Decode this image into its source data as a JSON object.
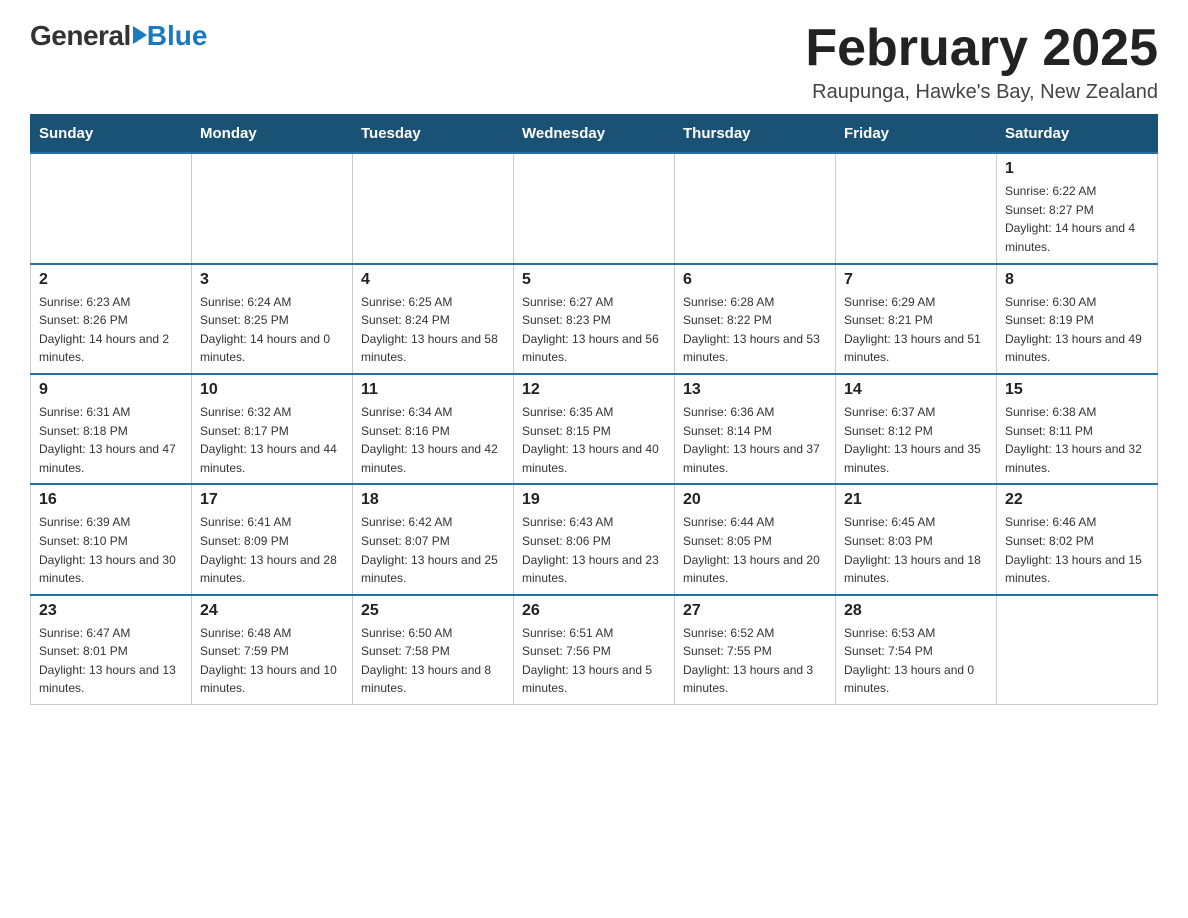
{
  "header": {
    "logo": {
      "general": "General",
      "blue": "Blue"
    },
    "title": "February 2025",
    "location": "Raupunga, Hawke's Bay, New Zealand"
  },
  "weekdays": [
    "Sunday",
    "Monday",
    "Tuesday",
    "Wednesday",
    "Thursday",
    "Friday",
    "Saturday"
  ],
  "weeks": [
    [
      {
        "day": "",
        "info": ""
      },
      {
        "day": "",
        "info": ""
      },
      {
        "day": "",
        "info": ""
      },
      {
        "day": "",
        "info": ""
      },
      {
        "day": "",
        "info": ""
      },
      {
        "day": "",
        "info": ""
      },
      {
        "day": "1",
        "info": "Sunrise: 6:22 AM\nSunset: 8:27 PM\nDaylight: 14 hours and 4 minutes."
      }
    ],
    [
      {
        "day": "2",
        "info": "Sunrise: 6:23 AM\nSunset: 8:26 PM\nDaylight: 14 hours and 2 minutes."
      },
      {
        "day": "3",
        "info": "Sunrise: 6:24 AM\nSunset: 8:25 PM\nDaylight: 14 hours and 0 minutes."
      },
      {
        "day": "4",
        "info": "Sunrise: 6:25 AM\nSunset: 8:24 PM\nDaylight: 13 hours and 58 minutes."
      },
      {
        "day": "5",
        "info": "Sunrise: 6:27 AM\nSunset: 8:23 PM\nDaylight: 13 hours and 56 minutes."
      },
      {
        "day": "6",
        "info": "Sunrise: 6:28 AM\nSunset: 8:22 PM\nDaylight: 13 hours and 53 minutes."
      },
      {
        "day": "7",
        "info": "Sunrise: 6:29 AM\nSunset: 8:21 PM\nDaylight: 13 hours and 51 minutes."
      },
      {
        "day": "8",
        "info": "Sunrise: 6:30 AM\nSunset: 8:19 PM\nDaylight: 13 hours and 49 minutes."
      }
    ],
    [
      {
        "day": "9",
        "info": "Sunrise: 6:31 AM\nSunset: 8:18 PM\nDaylight: 13 hours and 47 minutes."
      },
      {
        "day": "10",
        "info": "Sunrise: 6:32 AM\nSunset: 8:17 PM\nDaylight: 13 hours and 44 minutes."
      },
      {
        "day": "11",
        "info": "Sunrise: 6:34 AM\nSunset: 8:16 PM\nDaylight: 13 hours and 42 minutes."
      },
      {
        "day": "12",
        "info": "Sunrise: 6:35 AM\nSunset: 8:15 PM\nDaylight: 13 hours and 40 minutes."
      },
      {
        "day": "13",
        "info": "Sunrise: 6:36 AM\nSunset: 8:14 PM\nDaylight: 13 hours and 37 minutes."
      },
      {
        "day": "14",
        "info": "Sunrise: 6:37 AM\nSunset: 8:12 PM\nDaylight: 13 hours and 35 minutes."
      },
      {
        "day": "15",
        "info": "Sunrise: 6:38 AM\nSunset: 8:11 PM\nDaylight: 13 hours and 32 minutes."
      }
    ],
    [
      {
        "day": "16",
        "info": "Sunrise: 6:39 AM\nSunset: 8:10 PM\nDaylight: 13 hours and 30 minutes."
      },
      {
        "day": "17",
        "info": "Sunrise: 6:41 AM\nSunset: 8:09 PM\nDaylight: 13 hours and 28 minutes."
      },
      {
        "day": "18",
        "info": "Sunrise: 6:42 AM\nSunset: 8:07 PM\nDaylight: 13 hours and 25 minutes."
      },
      {
        "day": "19",
        "info": "Sunrise: 6:43 AM\nSunset: 8:06 PM\nDaylight: 13 hours and 23 minutes."
      },
      {
        "day": "20",
        "info": "Sunrise: 6:44 AM\nSunset: 8:05 PM\nDaylight: 13 hours and 20 minutes."
      },
      {
        "day": "21",
        "info": "Sunrise: 6:45 AM\nSunset: 8:03 PM\nDaylight: 13 hours and 18 minutes."
      },
      {
        "day": "22",
        "info": "Sunrise: 6:46 AM\nSunset: 8:02 PM\nDaylight: 13 hours and 15 minutes."
      }
    ],
    [
      {
        "day": "23",
        "info": "Sunrise: 6:47 AM\nSunset: 8:01 PM\nDaylight: 13 hours and 13 minutes."
      },
      {
        "day": "24",
        "info": "Sunrise: 6:48 AM\nSunset: 7:59 PM\nDaylight: 13 hours and 10 minutes."
      },
      {
        "day": "25",
        "info": "Sunrise: 6:50 AM\nSunset: 7:58 PM\nDaylight: 13 hours and 8 minutes."
      },
      {
        "day": "26",
        "info": "Sunrise: 6:51 AM\nSunset: 7:56 PM\nDaylight: 13 hours and 5 minutes."
      },
      {
        "day": "27",
        "info": "Sunrise: 6:52 AM\nSunset: 7:55 PM\nDaylight: 13 hours and 3 minutes."
      },
      {
        "day": "28",
        "info": "Sunrise: 6:53 AM\nSunset: 7:54 PM\nDaylight: 13 hours and 0 minutes."
      },
      {
        "day": "",
        "info": ""
      }
    ]
  ]
}
